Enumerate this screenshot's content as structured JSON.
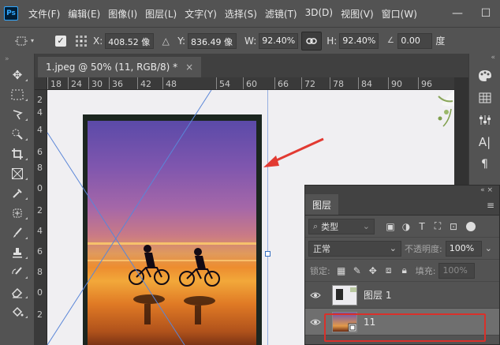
{
  "app": {
    "logo": "Ps"
  },
  "menu": [
    "文件(F)",
    "编辑(E)",
    "图像(I)",
    "图层(L)",
    "文字(Y)",
    "选择(S)",
    "滤镜(T)",
    "3D(D)",
    "视图(V)",
    "窗口(W)"
  ],
  "window_controls": {
    "minimize": "—",
    "maximize": "☐"
  },
  "options": {
    "x_label": "X:",
    "x_value": "408.52 像",
    "y_label": "Y:",
    "y_value": "836.49 像",
    "w_label": "W:",
    "w_value": "92.40%",
    "h_label": "H:",
    "h_value": "92.40%",
    "angle_value": "0.00",
    "angle_unit": "度"
  },
  "document": {
    "tab_title": "1.jpeg @ 50% (11, RGB/8) *",
    "tab_close": "×",
    "ruler_top": [
      "18",
      "24",
      "30",
      "36",
      "42",
      "48",
      "54",
      "60",
      "66",
      "72",
      "78",
      "84",
      "90",
      "96"
    ],
    "ruler_left": [
      "2",
      "4",
      "4",
      "6",
      "8",
      "0",
      "2",
      "4",
      "6",
      "8",
      "0",
      "2"
    ]
  },
  "layers_panel": {
    "title": "图层",
    "filter_label": "类型",
    "blend_mode": "正常",
    "opacity_label": "不透明度:",
    "opacity_value": "100%",
    "lock_label": "锁定:",
    "fill_label": "填充:",
    "fill_value": "100%",
    "layers": [
      {
        "name": "图层 1",
        "active": false
      },
      {
        "name": "11",
        "active": true
      }
    ]
  },
  "colors": {
    "highlight": "#d9302a",
    "arrow": "#e23a32",
    "accent": "#31a8ff"
  }
}
